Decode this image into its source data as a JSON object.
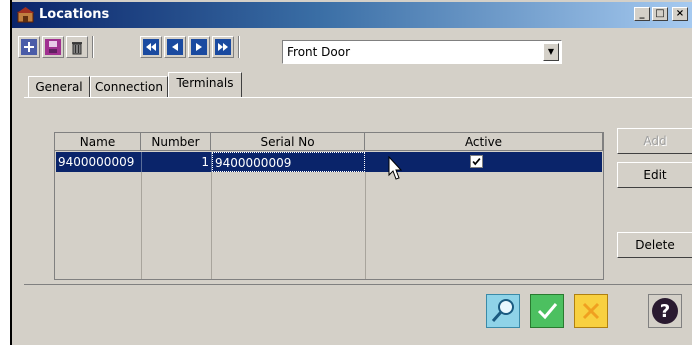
{
  "window": {
    "title": "Locations"
  },
  "toolbar": {
    "location_value": "Front Door"
  },
  "tabs": [
    {
      "label": "General"
    },
    {
      "label": "Connection"
    },
    {
      "label": "Terminals"
    }
  ],
  "grid": {
    "headers": [
      "Name",
      "Number",
      "Serial No",
      "Active"
    ],
    "rows": [
      {
        "name": "9400000009",
        "number": "1",
        "serial": "9400000009",
        "active": true
      }
    ]
  },
  "buttons": {
    "add": "Add",
    "edit": "Edit",
    "delete": "Delete"
  },
  "colors": {
    "selection": "#0a246a",
    "face": "#d4d0c8"
  }
}
